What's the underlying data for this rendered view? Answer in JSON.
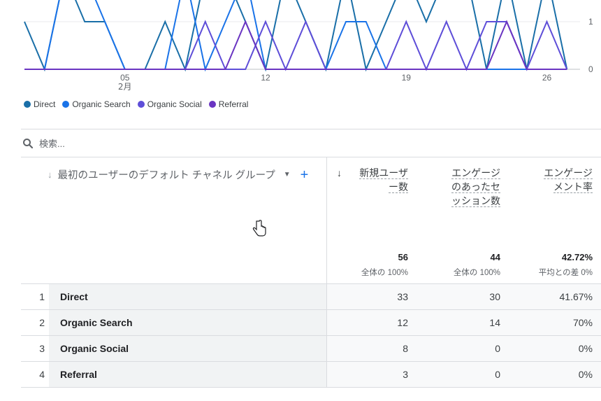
{
  "chart_data": {
    "type": "line",
    "x": [
      31,
      1,
      2,
      3,
      4,
      5,
      6,
      7,
      8,
      9,
      10,
      11,
      12,
      13,
      14,
      15,
      16,
      17,
      18,
      19,
      20,
      21,
      22,
      23,
      24,
      25,
      26,
      27
    ],
    "x_tick_labels": [
      "05",
      "12",
      "19",
      "26"
    ],
    "x_month_label": "2月",
    "y_tick_labels": [
      "1",
      "0"
    ],
    "ylim": [
      0,
      2
    ],
    "series": [
      {
        "name": "Direct",
        "color": "#1a6fa8",
        "values": [
          1,
          0,
          2,
          1,
          1,
          0,
          0,
          1,
          0,
          2,
          2,
          1,
          0,
          2,
          1,
          0,
          2,
          0,
          1,
          2,
          1,
          2,
          2,
          0,
          2,
          0,
          2,
          0
        ]
      },
      {
        "name": "Organic Search",
        "color": "#1a73e8",
        "values": [
          0,
          0,
          2,
          2,
          1,
          0,
          0,
          0,
          2,
          0,
          1,
          2,
          0,
          0,
          0,
          0,
          1,
          1,
          0,
          0,
          0,
          0,
          0,
          0,
          0,
          0,
          0,
          0
        ]
      },
      {
        "name": "Organic Social",
        "color": "#5e4ed8",
        "values": [
          0,
          0,
          0,
          0,
          0,
          0,
          0,
          0,
          0,
          1,
          0,
          0,
          1,
          0,
          1,
          0,
          0,
          0,
          0,
          1,
          0,
          1,
          0,
          1,
          1,
          0,
          1,
          0
        ]
      },
      {
        "name": "Referral",
        "color": "#6a35c2",
        "values": [
          0,
          0,
          0,
          0,
          0,
          0,
          0,
          0,
          0,
          0,
          0,
          1,
          0,
          0,
          0,
          0,
          0,
          0,
          0,
          0,
          0,
          0,
          0,
          0,
          1,
          0,
          0,
          0
        ]
      }
    ]
  },
  "search": {
    "placeholder": "検索..."
  },
  "table": {
    "dimension_header": "最初のユーザーのデフォルト チャネル グループ",
    "metrics": [
      {
        "label_lines": [
          "新規ユーザ",
          "ー数"
        ],
        "total": "56",
        "total_sub": "全体の 100%"
      },
      {
        "label_lines": [
          "エンゲージ",
          "のあったセ",
          "ッション数"
        ],
        "total": "44",
        "total_sub": "全体の 100%"
      },
      {
        "label_lines": [
          "エンゲージ",
          "メント率"
        ],
        "total": "42.72%",
        "total_sub": "平均との差 0%"
      }
    ],
    "rows": [
      {
        "index": "1",
        "channel": "Direct",
        "new_users": "33",
        "engaged_sessions": "30",
        "engagement_rate": "41.67%"
      },
      {
        "index": "2",
        "channel": "Organic Search",
        "new_users": "12",
        "engaged_sessions": "14",
        "engagement_rate": "70%"
      },
      {
        "index": "3",
        "channel": "Organic Social",
        "new_users": "8",
        "engaged_sessions": "0",
        "engagement_rate": "0%"
      },
      {
        "index": "4",
        "channel": "Referral",
        "new_users": "3",
        "engaged_sessions": "0",
        "engagement_rate": "0%"
      }
    ]
  }
}
